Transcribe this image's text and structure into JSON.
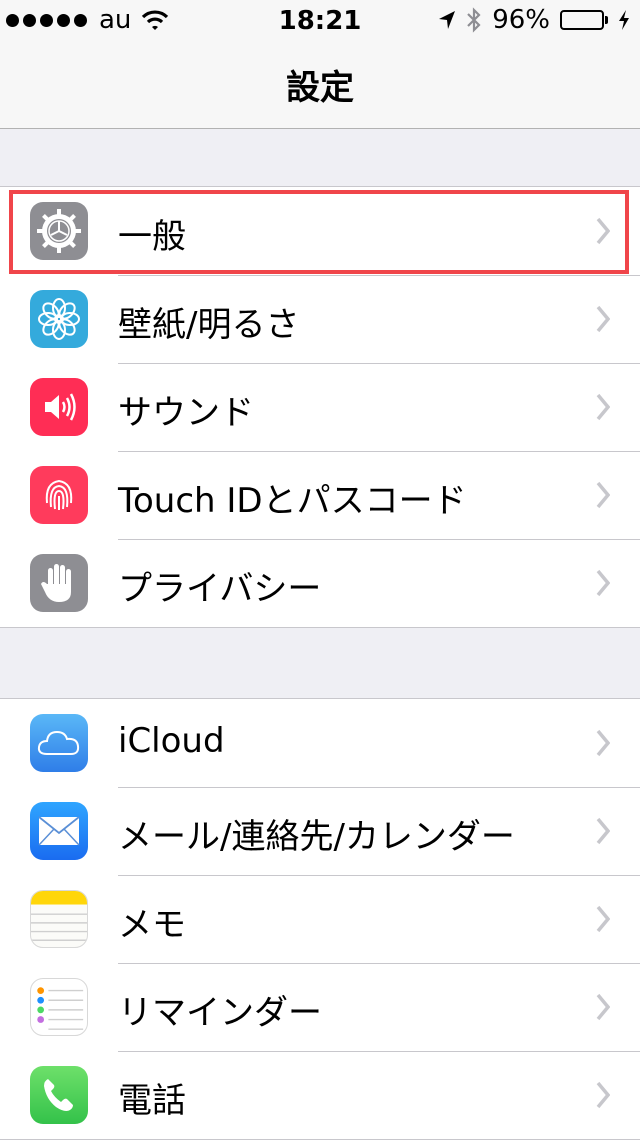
{
  "status_bar": {
    "carrier": "au",
    "time": "18:21",
    "battery_percent_text": "96%",
    "battery_level": 0.96,
    "icons": [
      "signal-dots-icon",
      "wifi-icon",
      "location-arrow-icon",
      "bluetooth-icon",
      "battery-icon",
      "charging-icon"
    ]
  },
  "nav": {
    "title": "設定"
  },
  "groups": [
    {
      "items": [
        {
          "label": "一般",
          "icon": "gear-icon",
          "icon_color": "#8e8e93"
        },
        {
          "label": "壁紙/明るさ",
          "icon": "flower-icon",
          "icon_color": "#34aadc"
        },
        {
          "label": "サウンド",
          "icon": "speaker-icon",
          "icon_color": "#ff2d55"
        },
        {
          "label": "Touch IDとパスコード",
          "icon": "fingerprint-icon",
          "icon_color": "#ff3b5c"
        },
        {
          "label": "プライバシー",
          "icon": "hand-icon",
          "icon_color": "#8e8e93"
        }
      ]
    },
    {
      "items": [
        {
          "label": "iCloud",
          "icon": "cloud-icon",
          "icon_color": "#4a9ff5"
        },
        {
          "label": "メール/連絡先/カレンダー",
          "icon": "envelope-icon",
          "icon_color": "#1e90ff"
        },
        {
          "label": "メモ",
          "icon": "notepad-icon",
          "icon_color": "#ffd60a"
        },
        {
          "label": "リマインダー",
          "icon": "list-icon",
          "icon_color": "#ffffff"
        },
        {
          "label": "電話",
          "icon": "phone-icon",
          "icon_color": "#4cd964"
        }
      ]
    }
  ],
  "highlight_color": "#f0454a"
}
